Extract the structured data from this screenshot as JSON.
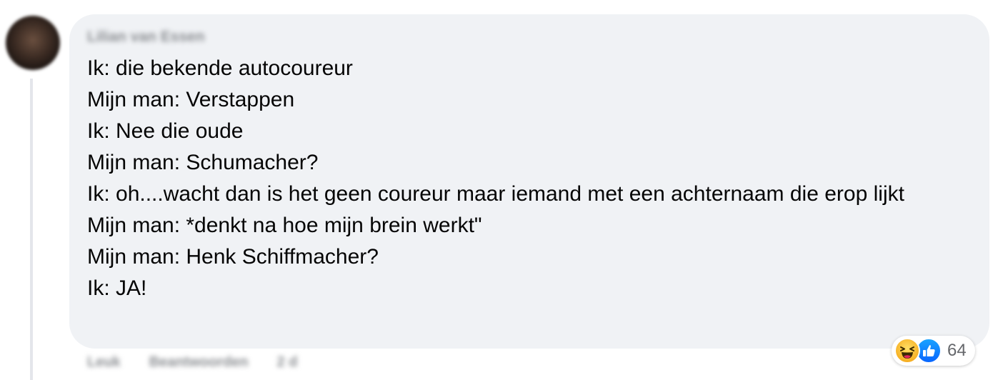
{
  "comment": {
    "author": "Lilian van Essen",
    "lines": [
      "Ik: die bekende autocoureur",
      "Mijn man: Verstappen",
      "Ik: Nee die oude",
      "Mijn man: Schumacher?",
      "Ik: oh....wacht dan is het geen coureur maar iemand met een achternaam die erop lijkt",
      "Mijn man: *denkt na hoe mijn brein werkt\"",
      "Mijn man: Henk Schiffmacher?",
      "Ik: JA!"
    ]
  },
  "reactions": {
    "icons": [
      "haha-icon",
      "like-icon"
    ],
    "count": "64"
  },
  "actions": {
    "like_label": "Leuk",
    "reply_label": "Beantwoorden",
    "time_label": "2 d"
  },
  "colors": {
    "bubble_bg": "#f0f2f5",
    "text": "#050505",
    "secondary_text": "#65676b",
    "like_blue": "#0866ff",
    "haha_yellow": "#f7b125"
  }
}
